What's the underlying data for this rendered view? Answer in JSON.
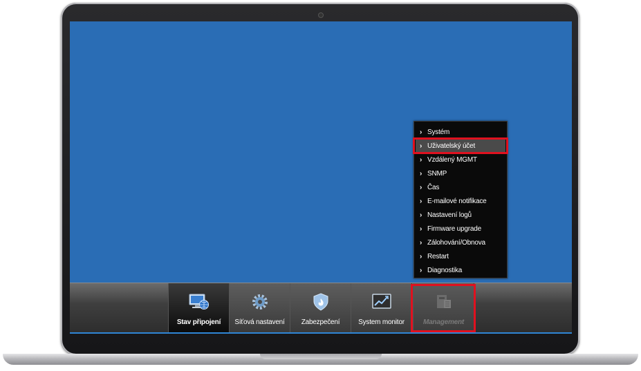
{
  "screen": {
    "background": "#2a6db5"
  },
  "taskbar": {
    "tabs": [
      {
        "label": "Stav připojení",
        "icon": "monitor-globe-icon",
        "state": "active"
      },
      {
        "label": "Síťová nastavení",
        "icon": "gear-icon",
        "state": "normal"
      },
      {
        "label": "Zabezpečení",
        "icon": "shield-fire-icon",
        "state": "normal"
      },
      {
        "label": "System monitor",
        "icon": "chart-monitor-icon",
        "state": "normal"
      },
      {
        "label": "Management",
        "icon": "management-icon",
        "state": "hover"
      }
    ]
  },
  "menu": {
    "items": [
      {
        "label": "Systém"
      },
      {
        "label": "Uživatelský účet",
        "selected": true
      },
      {
        "label": "Vzdálený MGMT"
      },
      {
        "label": "SNMP"
      },
      {
        "label": "Čas"
      },
      {
        "label": "E-mailové notifikace"
      },
      {
        "label": "Nastavení logů"
      },
      {
        "label": "Firmware upgrade"
      },
      {
        "label": "Zálohování/Obnova"
      },
      {
        "label": "Restart"
      },
      {
        "label": "Diagnostika"
      }
    ],
    "chevron": "›"
  },
  "colors": {
    "highlight": "#e0111f",
    "accent": "#2f86d6"
  }
}
